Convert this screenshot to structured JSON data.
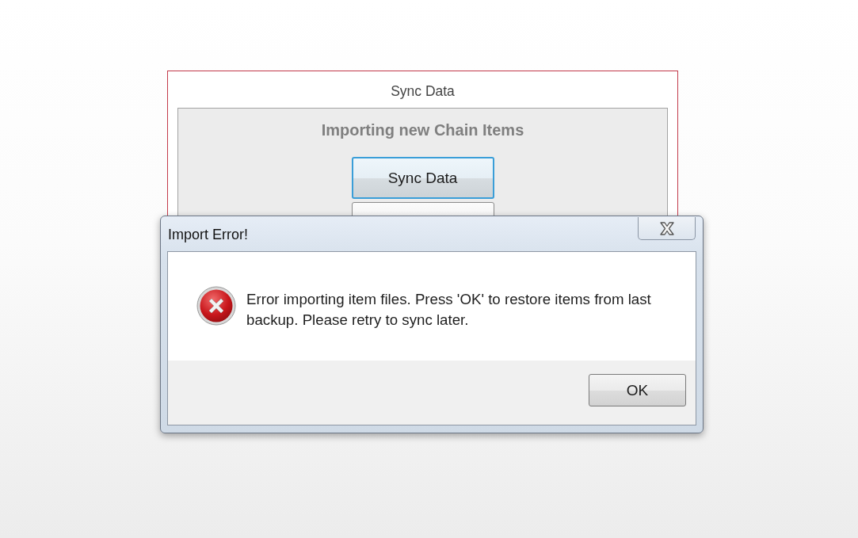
{
  "sync_window": {
    "title": "Sync Data",
    "heading": "Importing new Chain Items",
    "buttons": [
      {
        "label": "Sync Data",
        "focused": true
      },
      {
        "focused": false
      }
    ]
  },
  "dialog": {
    "title": "Import Error!",
    "message": "Error importing item files. Press 'OK' to restore items from last backup. Please retry to sync later.",
    "buttons": [
      {
        "label": "OK",
        "focused": false
      }
    ]
  }
}
